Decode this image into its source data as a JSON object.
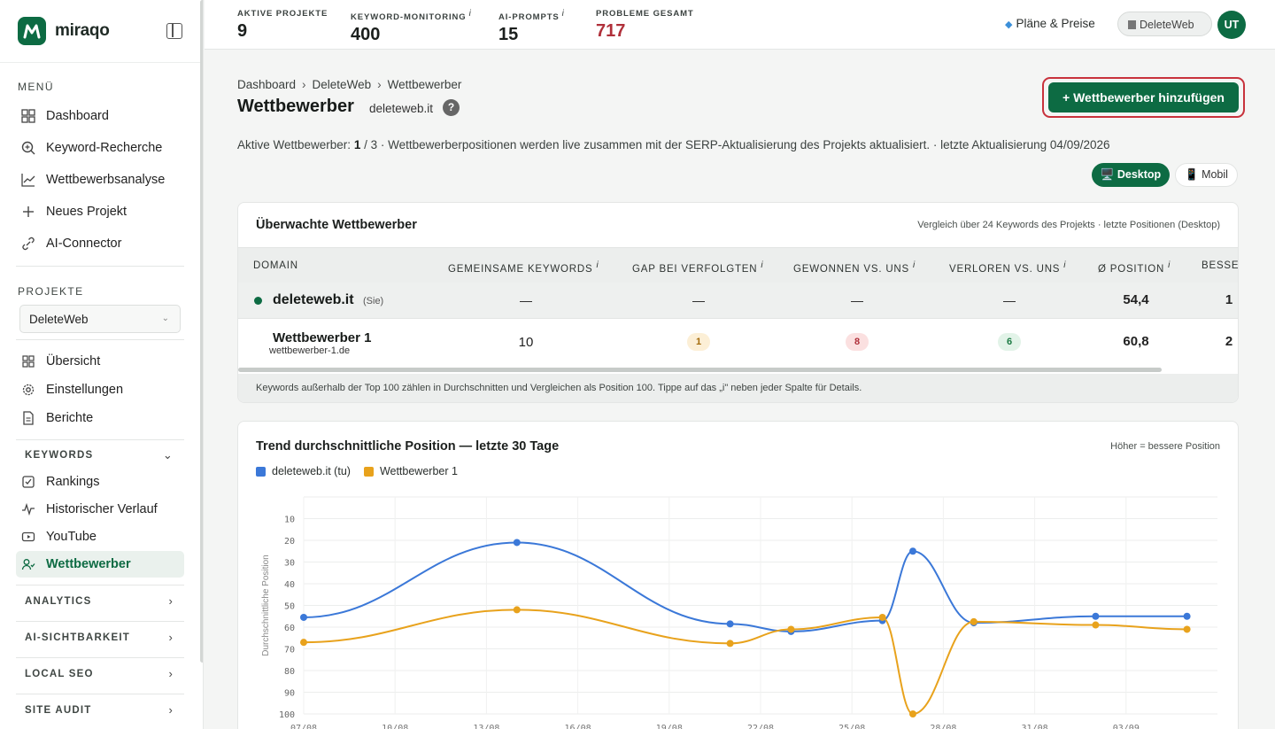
{
  "app": {
    "name": "miraqo"
  },
  "sidebar": {
    "menu_title": "MENÜ",
    "menu": [
      {
        "label": "Dashboard",
        "icon": "grid-icon"
      },
      {
        "label": "Keyword-Recherche",
        "icon": "search-icon"
      },
      {
        "label": "Wettbewerbsanalyse",
        "icon": "trend-icon"
      },
      {
        "label": "Neues Projekt",
        "icon": "plus-icon"
      },
      {
        "label": "AI-Connector",
        "icon": "link-icon"
      }
    ],
    "projects_title": "PROJEKTE",
    "project_selected": "DeleteWeb",
    "project_nav": [
      {
        "label": "Übersicht",
        "icon": "grid-icon"
      },
      {
        "label": "Einstellungen",
        "icon": "gear-icon"
      },
      {
        "label": "Berichte",
        "icon": "document-icon"
      }
    ],
    "keywords_group": "KEYWORDS",
    "keywords_nav": [
      {
        "label": "Rankings",
        "icon": "checkbox-icon"
      },
      {
        "label": "Historischer Verlauf",
        "icon": "pulse-icon"
      },
      {
        "label": "YouTube",
        "icon": "video-icon"
      },
      {
        "label": "Wettbewerber",
        "icon": "users-icon",
        "active": true
      }
    ],
    "groups": [
      "ANALYTICS",
      "AI-SICHTBARKEIT",
      "LOCAL SEO",
      "SITE AUDIT"
    ]
  },
  "topbar": {
    "stats": [
      {
        "label": "AKTIVE PROJEKTE",
        "value": "9",
        "info": false
      },
      {
        "label": "KEYWORD-MONITORING",
        "value": "400",
        "info": true
      },
      {
        "label": "AI-PROMPTS",
        "value": "15",
        "info": true
      },
      {
        "label": "PROBLEME GESAMT",
        "value": "717",
        "info": false,
        "color": "#b0303a"
      }
    ],
    "plans": "Pläne & Preise",
    "project_chip": "DeleteWeb",
    "avatar": "UT"
  },
  "page": {
    "breadcrumb": [
      "Dashboard",
      "DeleteWeb",
      "Wettbewerber"
    ],
    "title": "Wettbewerber",
    "domain": "deleteweb.it",
    "add_button": "+ Wettbewerber hinzufügen",
    "info_prefix": "Aktive Wettbewerber: ",
    "info_count": "1",
    "info_rest": " / 3 · Wettbewerberpositionen werden live zusammen mit der SERP-Aktualisierung des Projekts aktualisiert. · letzte Aktualisierung 04/09/2026",
    "device_desktop": "🖥️ Desktop",
    "device_mobile": "📱 Mobil"
  },
  "table": {
    "title": "Überwachte Wettbewerber",
    "subtitle": "Vergleich über 24 Keywords des Projekts · letzte Positionen (Desktop)",
    "columns": [
      "DOMAIN",
      "GEMEINSAME KEYWORDS",
      "GAP BEI VERFOLGTEN",
      "GEWONNEN VS. UNS",
      "VERLOREN VS. UNS",
      "Ø POSITION",
      "BESSE"
    ],
    "self_row": {
      "domain": "deleteweb.it",
      "tag": "(Sie)",
      "shared": "—",
      "gap": "—",
      "won": "—",
      "lost": "—",
      "avg": "54,4",
      "better": "1"
    },
    "rows": [
      {
        "name": "Wettbewerber 1",
        "domain": "wettbewerber-1.de",
        "shared": "10",
        "gap": "1",
        "won": "8",
        "lost": "6",
        "avg": "60,8",
        "better": "2"
      }
    ],
    "footnote": "Keywords außerhalb der Top 100 zählen in Durchschnitten und Vergleichen als Position 100. Tippe auf das „i\" neben jeder Spalte für Details."
  },
  "chart_data": {
    "type": "line",
    "title": "Trend durchschnittliche Position — letzte 30 Tage",
    "note": "Höher = bessere Position",
    "ylabel": "Durchschnittliche Position",
    "xlabel": "",
    "ylim": [
      100,
      0
    ],
    "y_reversed": true,
    "yticks": [
      10,
      20,
      30,
      40,
      50,
      60,
      70,
      80,
      90,
      100
    ],
    "xticks": [
      "07/08",
      "10/08",
      "13/08",
      "16/08",
      "19/08",
      "22/08",
      "25/08",
      "28/08",
      "31/08",
      "03/09"
    ],
    "grid": true,
    "legend": "top-left",
    "series": [
      {
        "name": "deleteweb.it (tu)",
        "color": "#3b78d8",
        "points": [
          [
            "07/08",
            55.5
          ],
          [
            "14/08",
            21
          ],
          [
            "21/08",
            58.5
          ],
          [
            "23/08",
            62
          ],
          [
            "26/08",
            57
          ],
          [
            "27/08",
            25
          ],
          [
            "29/08",
            58
          ],
          [
            "02/09",
            55
          ],
          [
            "05/09",
            55
          ]
        ]
      },
      {
        "name": "Wettbewerber 1",
        "color": "#e8a21c",
        "points": [
          [
            "07/08",
            67
          ],
          [
            "14/08",
            52
          ],
          [
            "21/08",
            67.5
          ],
          [
            "23/08",
            61
          ],
          [
            "26/08",
            55.5
          ],
          [
            "27/08",
            100
          ],
          [
            "29/08",
            57.5
          ],
          [
            "02/09",
            59
          ],
          [
            "05/09",
            61
          ]
        ]
      }
    ]
  }
}
